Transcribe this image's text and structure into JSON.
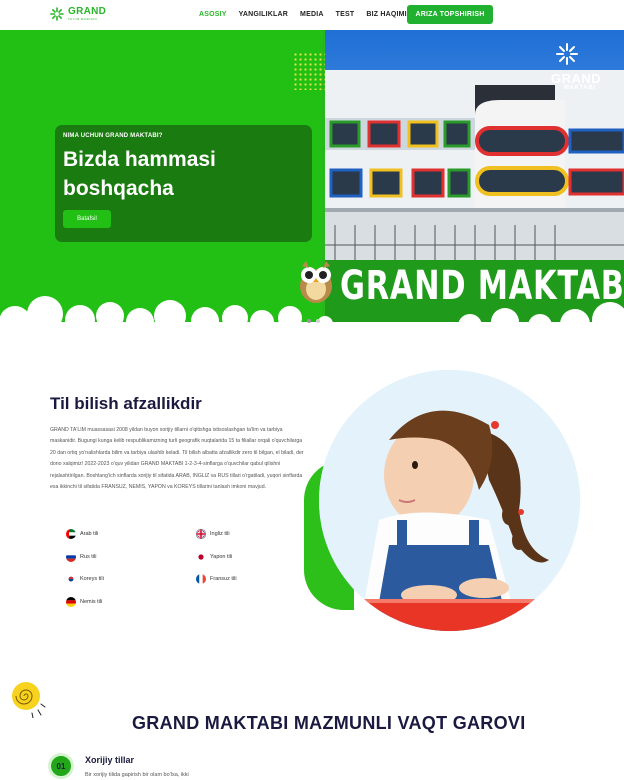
{
  "header": {
    "logo_text": "GRAND",
    "logo_sub": "TA'LIM MASKANI",
    "nav": [
      {
        "label": "ASOSIY",
        "active": true
      },
      {
        "label": "YANGILIKLAR",
        "active": false
      },
      {
        "label": "MEDIA",
        "active": false
      },
      {
        "label": "TEST",
        "active": false
      },
      {
        "label": "BIZ HAQIMIZDA",
        "active": false
      }
    ],
    "cta_label": "ARIZA TOPSHIRISH"
  },
  "hero": {
    "kicker": "NIMA UCHUN GRAND MAKTABI?",
    "title": "Bizda hammasi boshqacha",
    "button": "Batafsil",
    "photo_logo": "GRAND",
    "photo_logo_sub": "MAKTABI",
    "banner_text": "GRAND MAKTABI",
    "slider_count": 2,
    "slider_active": 0
  },
  "languages_section": {
    "title": "Til bilish afzallikdir",
    "text": "GRAND TA'LIM muassasasi 2008 yildan buyon xorijiy tillarni o'qitishga ixtisoslashgan ta'lim va tarbiya maskanidir. Bugungi kunga kelib respublikamizning turli geografik nuqtalarida 15 ta filiallar orqali o'quvchilarga 20 dan ortiq yo'nalishlarda bilim va tarbiya ulashib keladi. Til bilish albatta afzallikdir zero til bilgan, el biladi, der dono xalqimiz! 2022-2023 o'quv yilidan GRAND MAKTABI 1-2-3-4-sinflarga o'quvchilar qabul qilishni rejalashtirilgan. Boshlang'ich sinflarda xorijiy til sifatida ARAB, INGLIZ va RUS tillari o'rgatiladi, yuqori sinflarda esa ikkinchi til sifatida FRANSUZ, NEMIS, YAPON va KOREYS tillarini tanlash imkoni mavjud.",
    "languages": [
      {
        "label": "Arab tili",
        "flag": "uae-flag"
      },
      {
        "label": "Ingliz tili",
        "flag": "uk-flag"
      },
      {
        "label": "Rus tili",
        "flag": "russia-flag"
      },
      {
        "label": "Yapon tili",
        "flag": "japan-flag"
      },
      {
        "label": "Koreys tili",
        "flag": "korea-flag"
      },
      {
        "label": "Fransuz tili",
        "flag": "france-flag"
      },
      {
        "label": "Nemis tili",
        "flag": "germany-flag"
      }
    ]
  },
  "features_section": {
    "title": "GRAND MAKTABI MAZMUNLI VAQT GAROVI",
    "items": [
      {
        "number": "01",
        "title": "Xorijiy tillar",
        "text": "Bir xorijiy tilida gapirish bir olam bo'lsa, ikki"
      }
    ]
  },
  "colors": {
    "brand_green": "#22c015",
    "dark_green": "#1a7b10",
    "navy": "#1a1a40"
  }
}
